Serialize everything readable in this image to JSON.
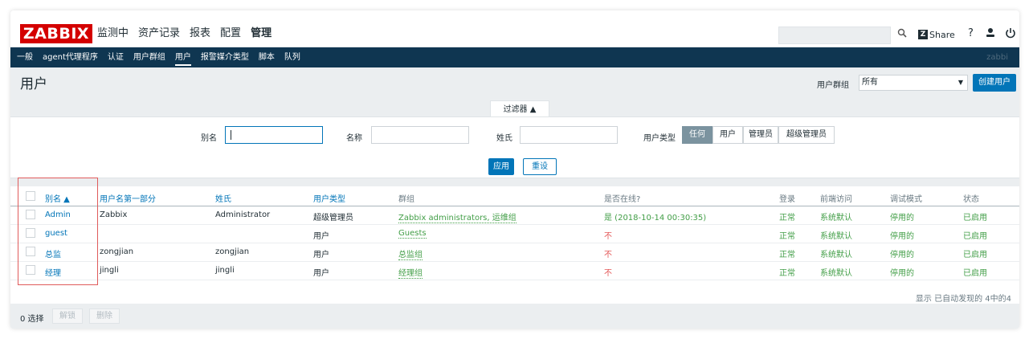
{
  "header": {
    "logo": "ZABBIX",
    "menu": [
      "监测中",
      "资产记录",
      "报表",
      "配置",
      "管理"
    ],
    "active_menu": "管理",
    "search_value": "",
    "share_label": "Share",
    "share_badge": "Z",
    "help_label": "?"
  },
  "subnav": {
    "items": [
      "一般",
      "agent代理程序",
      "认证",
      "用户群组",
      "用户",
      "报警媒介类型",
      "脚本",
      "队列"
    ],
    "active": "用户",
    "right_text": "zabbi"
  },
  "page": {
    "title": "用户",
    "group_label": "用户群组",
    "group_value": "所有",
    "create_button": "创建用户"
  },
  "filter": {
    "tab_label": "过滤器 ▲",
    "alias_label": "别名",
    "alias_value": "",
    "name_label": "名称",
    "name_value": "",
    "surname_label": "姓氏",
    "surname_value": "",
    "user_type_label": "用户类型",
    "user_type_options": [
      "任何",
      "用户",
      "管理员",
      "超级管理员"
    ],
    "user_type_selected": "任何",
    "apply_button": "应用",
    "reset_button": "重设"
  },
  "table": {
    "columns": [
      "别名 ▲",
      "用户名第一部分",
      "姓氏",
      "用户类型",
      "群组",
      "是否在线?",
      "登录",
      "前端访问",
      "调试模式",
      "状态"
    ],
    "rows": [
      {
        "alias": "Admin",
        "name": "Zabbix",
        "surname": "Administrator",
        "type": "超级管理员",
        "groups": "Zabbix administrators, 运维组",
        "online": "是 (2018-10-14 00:30:35)",
        "login": "正常",
        "frontend": "系统默认",
        "debug": "停用的",
        "status": "已启用"
      },
      {
        "alias": "guest",
        "name": "",
        "surname": "",
        "type": "用户",
        "groups": "Guests",
        "online": "不",
        "login": "正常",
        "frontend": "系统默认",
        "debug": "停用的",
        "status": "已启用"
      },
      {
        "alias": "总监",
        "name": "zongjian",
        "surname": "zongjian",
        "type": "用户",
        "groups": "总监组",
        "online": "不",
        "login": "正常",
        "frontend": "系统默认",
        "debug": "停用的",
        "status": "已启用"
      },
      {
        "alias": "经理",
        "name": "jingli",
        "surname": "jingli",
        "type": "用户",
        "groups": "经理组",
        "online": "不",
        "login": "正常",
        "frontend": "系统默认",
        "debug": "停用的",
        "status": "已启用"
      }
    ],
    "summary": "显示 已自动发现的 4中的4"
  },
  "footer": {
    "selected": "0 选择",
    "unblock_button": "解锁",
    "delete_button": "删除"
  },
  "colors": {
    "brand_red": "#d40000",
    "nav_bg": "#0f3651",
    "link_blue": "#0275b8",
    "ok_green": "#429e47",
    "no_red": "#e45959"
  }
}
